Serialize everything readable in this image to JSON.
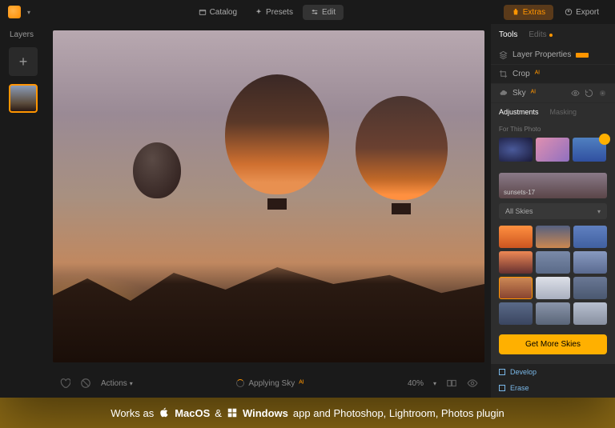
{
  "menubar": {
    "catalog": "Catalog",
    "presets": "Presets",
    "edit": "Edit",
    "extras": "Extras",
    "export": "Export"
  },
  "left_panel": {
    "title": "Layers"
  },
  "toolbar": {
    "actions": "Actions",
    "status": "Applying Sky",
    "zoom": "40%"
  },
  "right_panel": {
    "tabs": {
      "tools": "Tools",
      "edits": "Edits"
    },
    "layer_properties": "Layer Properties",
    "crop": "Crop",
    "sky": "Sky",
    "sub_tabs": {
      "adjustments": "Adjustments",
      "masking": "Masking"
    },
    "for_this_photo": "For This Photo",
    "preset_name": "sunsets-17",
    "all_skies": "All Skies",
    "cta": "Get More Skies",
    "develop": "Develop",
    "erase": "Erase"
  },
  "caption": {
    "prefix": "Works as",
    "macos": "MacOS",
    "amp": "&",
    "windows": "Windows",
    "suffix": "app and Photoshop, Lightroom, Photos plugin"
  }
}
